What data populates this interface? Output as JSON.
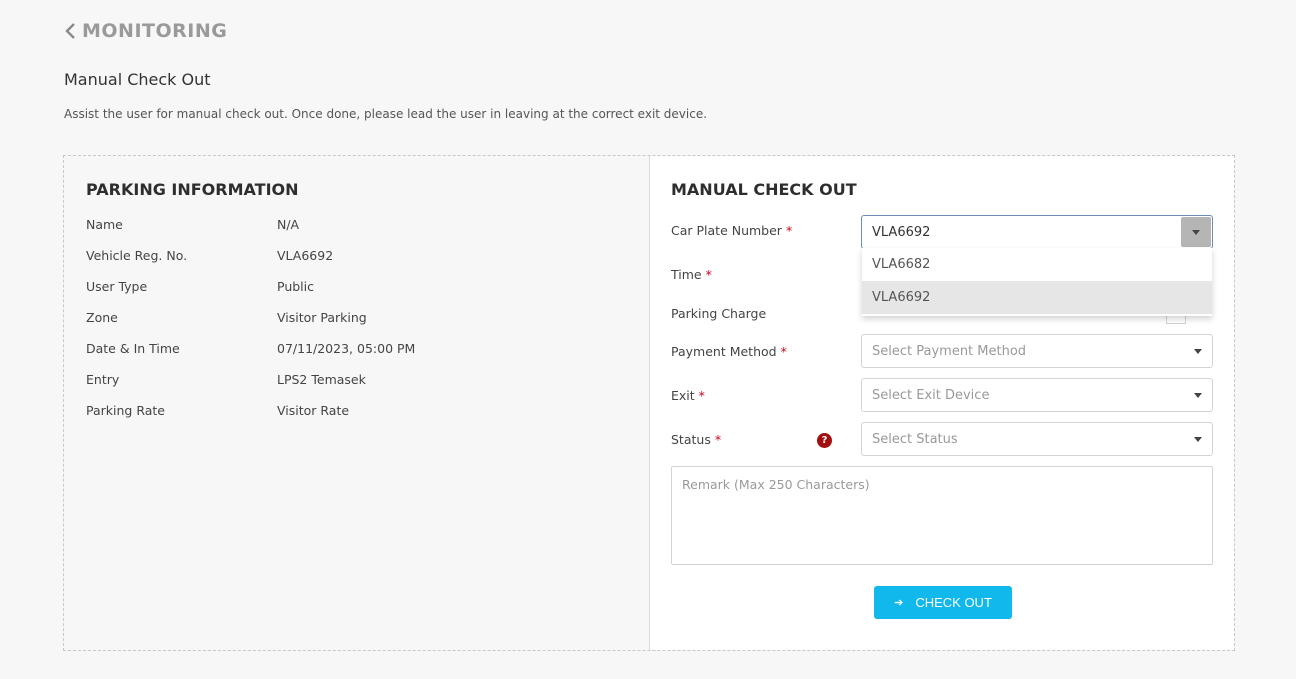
{
  "header": {
    "back_label": "MONITORING"
  },
  "page": {
    "title": "Manual Check Out",
    "description": "Assist the user for manual check out. Once done, please lead the user in leaving at the correct exit device."
  },
  "parking_info": {
    "title": "PARKING INFORMATION",
    "rows": [
      {
        "label": "Name",
        "value": "N/A"
      },
      {
        "label": "Vehicle Reg. No.",
        "value": "VLA6692"
      },
      {
        "label": "User Type",
        "value": "Public"
      },
      {
        "label": "Zone",
        "value": "Visitor Parking"
      },
      {
        "label": "Date & In Time",
        "value": "07/11/2023, 05:00 PM"
      },
      {
        "label": "Entry",
        "value": "LPS2 Temasek"
      },
      {
        "label": "Parking Rate",
        "value": "Visitor Rate"
      }
    ]
  },
  "manual_checkout": {
    "title": "MANUAL CHECK OUT",
    "required_mark": "*",
    "car_plate": {
      "label": "Car Plate Number",
      "value": "VLA6692",
      "options": [
        "VLA6682",
        "VLA6692"
      ],
      "highlighted_option": "VLA6692"
    },
    "time": {
      "label": "Time"
    },
    "parking_charge": {
      "label": "Parking Charge"
    },
    "payment_method": {
      "label": "Payment Method",
      "placeholder": "Select Payment Method"
    },
    "exit": {
      "label": "Exit",
      "placeholder": "Select Exit Device"
    },
    "status": {
      "label": "Status",
      "placeholder": "Select Status",
      "help_icon": "question-circle-icon"
    },
    "remark": {
      "placeholder": "Remark (Max 250 Characters)"
    },
    "checkout_button": {
      "label": "CHECK OUT",
      "icon": "sign-out-icon"
    }
  },
  "colors": {
    "primary_button": "#10b8eb",
    "required": "#d0021b",
    "help_icon": "#a50e0e"
  }
}
